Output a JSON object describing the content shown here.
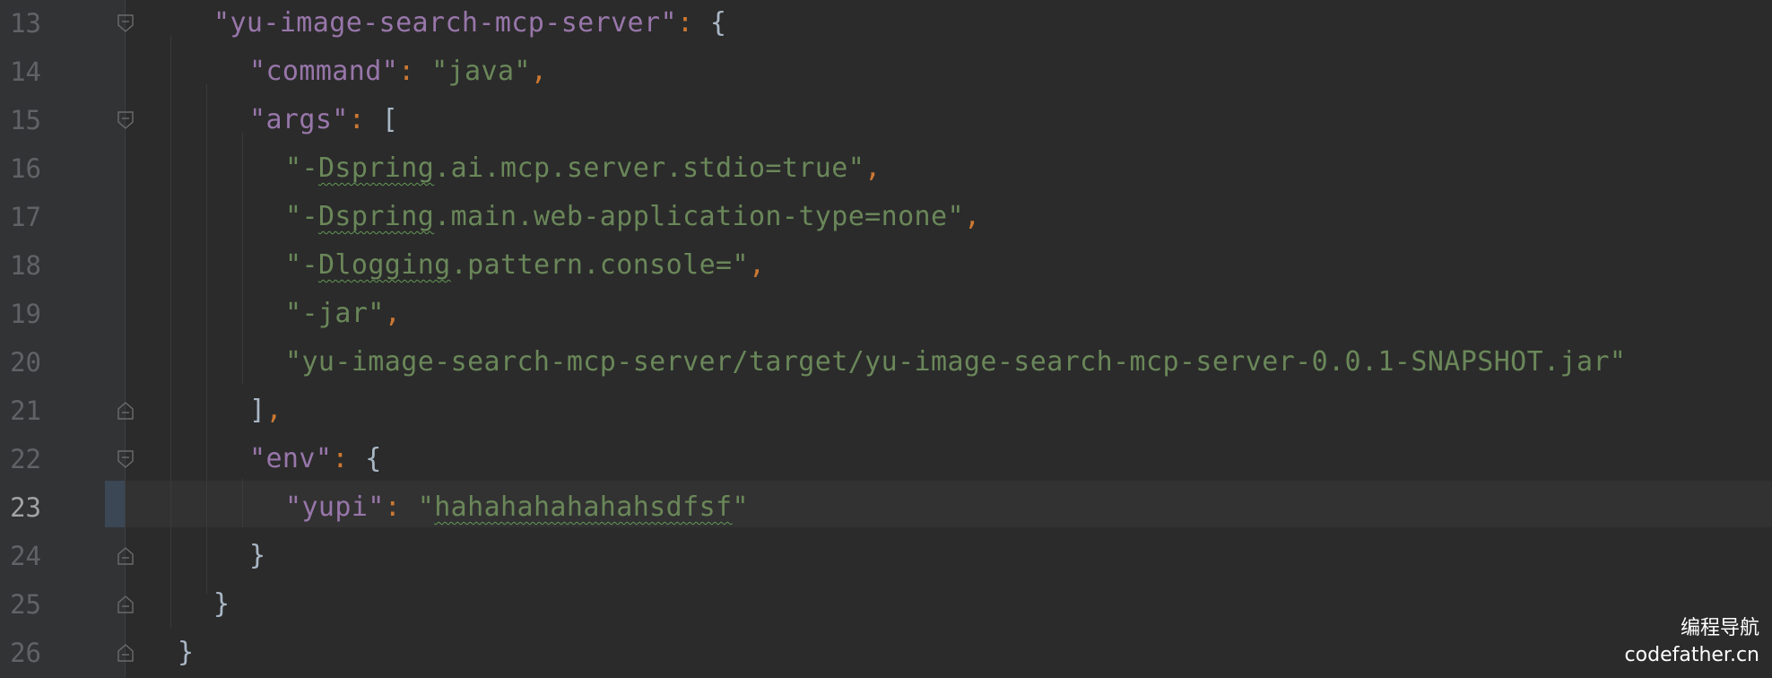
{
  "editor": {
    "lines": [
      {
        "num": "13",
        "tokens": [
          {
            "t": "\"yu-image-search-mcp-server\"",
            "c": "key"
          },
          {
            "t": ": ",
            "c": "punc"
          },
          {
            "t": "{",
            "c": "brace"
          }
        ]
      },
      {
        "num": "14",
        "tokens": [
          {
            "t": "\"command\"",
            "c": "key"
          },
          {
            "t": ": ",
            "c": "punc"
          },
          {
            "t": "\"java\"",
            "c": "str"
          },
          {
            "t": ",",
            "c": "punc"
          }
        ]
      },
      {
        "num": "15",
        "tokens": [
          {
            "t": "\"args\"",
            "c": "key"
          },
          {
            "t": ": ",
            "c": "punc"
          },
          {
            "t": "[",
            "c": "brace"
          }
        ]
      },
      {
        "num": "16",
        "tokens": [
          {
            "t": "\"-",
            "c": "str"
          },
          {
            "t": "Dspring",
            "c": "str typo"
          },
          {
            "t": ".ai.mcp.server.stdio=true\"",
            "c": "str"
          },
          {
            "t": ",",
            "c": "punc"
          }
        ]
      },
      {
        "num": "17",
        "tokens": [
          {
            "t": "\"-",
            "c": "str"
          },
          {
            "t": "Dspring",
            "c": "str typo"
          },
          {
            "t": ".main.web-application-type=none\"",
            "c": "str"
          },
          {
            "t": ",",
            "c": "punc"
          }
        ]
      },
      {
        "num": "18",
        "tokens": [
          {
            "t": "\"-",
            "c": "str"
          },
          {
            "t": "Dlogging",
            "c": "str typo"
          },
          {
            "t": ".pattern.console=\"",
            "c": "str"
          },
          {
            "t": ",",
            "c": "punc"
          }
        ]
      },
      {
        "num": "19",
        "tokens": [
          {
            "t": "\"-jar\"",
            "c": "str"
          },
          {
            "t": ",",
            "c": "punc"
          }
        ]
      },
      {
        "num": "20",
        "tokens": [
          {
            "t": "\"yu-image-search-mcp-server/target/yu-image-search-mcp-server-0.0.1-SNAPSHOT.jar\"",
            "c": "str"
          }
        ]
      },
      {
        "num": "21",
        "tokens": [
          {
            "t": "]",
            "c": "brace"
          },
          {
            "t": ",",
            "c": "punc"
          }
        ]
      },
      {
        "num": "22",
        "tokens": [
          {
            "t": "\"env\"",
            "c": "key"
          },
          {
            "t": ": ",
            "c": "punc"
          },
          {
            "t": "{",
            "c": "brace"
          }
        ]
      },
      {
        "num": "23",
        "current": true,
        "tokens": [
          {
            "t": "\"yupi\"",
            "c": "key"
          },
          {
            "t": ": ",
            "c": "punc"
          },
          {
            "t": "\"",
            "c": "str"
          },
          {
            "t": "hahahahahahahsdfsf",
            "c": "str typo"
          },
          {
            "t": "\"",
            "c": "str"
          }
        ]
      },
      {
        "num": "24",
        "tokens": [
          {
            "t": "}",
            "c": "brace"
          }
        ]
      },
      {
        "num": "25",
        "tokens": [
          {
            "t": "}",
            "c": "brace"
          }
        ]
      },
      {
        "num": "26",
        "tokens": [
          {
            "t": "}",
            "c": "brace"
          }
        ]
      }
    ]
  },
  "watermark": {
    "title": "编程导航",
    "site": "codefather.cn"
  },
  "colors": {
    "background": "#2b2b2b",
    "gutter": "#313335",
    "key": "#9876aa",
    "string": "#6a8759",
    "punctuation": "#cc7832",
    "brace": "#a9b7c6",
    "line_number": "#606366",
    "typo_underline": "#629755"
  },
  "icons": {
    "fold_open": "fold-open-icon",
    "fold_close": "fold-close-icon"
  }
}
